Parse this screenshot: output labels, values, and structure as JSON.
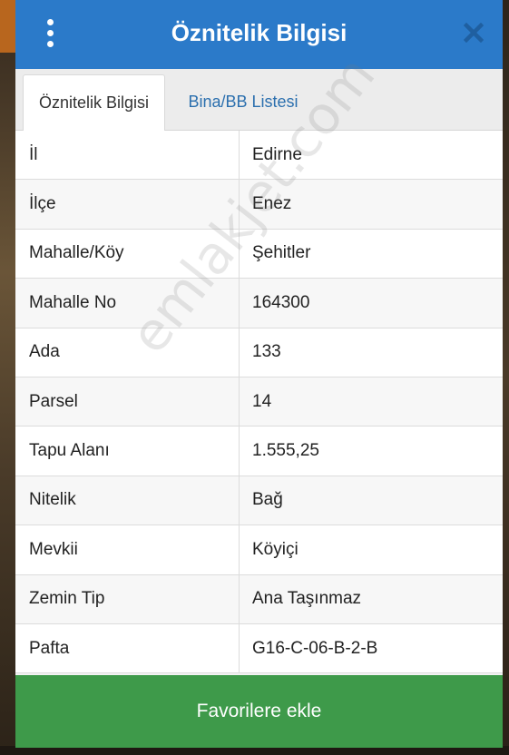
{
  "header": {
    "title": "Öznitelik Bilgisi"
  },
  "tabs": [
    {
      "label": "Öznitelik Bilgisi",
      "active": true
    },
    {
      "label": "Bina/BB Listesi",
      "active": false
    }
  ],
  "rows": [
    {
      "label": "İl",
      "value": "Edirne"
    },
    {
      "label": "İlçe",
      "value": "Enez"
    },
    {
      "label": "Mahalle/Köy",
      "value": "Şehitler"
    },
    {
      "label": "Mahalle No",
      "value": "164300"
    },
    {
      "label": "Ada",
      "value": "133"
    },
    {
      "label": "Parsel",
      "value": "14"
    },
    {
      "label": "Tapu Alanı",
      "value": "1.555,25"
    },
    {
      "label": "Nitelik",
      "value": "Bağ"
    },
    {
      "label": "Mevkii",
      "value": "Köyiçi"
    },
    {
      "label": "Zemin Tip",
      "value": "Ana Taşınmaz"
    },
    {
      "label": "Pafta",
      "value": "G16-C-06-B-2-B"
    }
  ],
  "footer": {
    "favorite_label": "Favorilere ekle"
  },
  "watermark": "emlakjet.com",
  "colors": {
    "header": "#2b7ac9",
    "tab_link": "#2b6fae",
    "favorite_button": "#3e9a4a"
  },
  "icons": {
    "menu": "kebab-menu-icon",
    "close": "close-icon"
  }
}
